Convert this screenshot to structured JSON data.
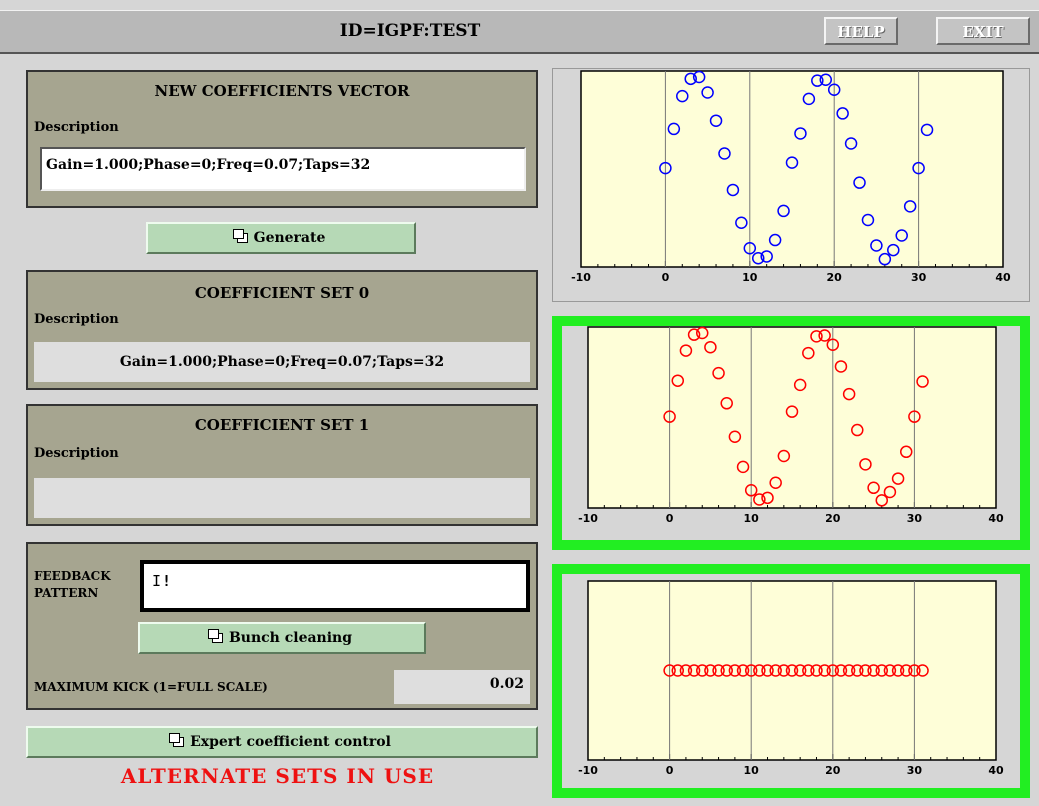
{
  "header": {
    "title": "ID=IGPF:TEST",
    "help_label": "HELP",
    "exit_label": "EXIT"
  },
  "new_coefficients": {
    "heading": "NEW COEFFICIENTS VECTOR",
    "description_label": "Description",
    "description_value": "Gain=1.000;Phase=0;Freq=0.07;Taps=32",
    "generate_label": "Generate"
  },
  "coefficient_set_0": {
    "heading": "COEFFICIENT SET 0",
    "description_label": "Description",
    "description_value": "Gain=1.000;Phase=0;Freq=0.07;Taps=32"
  },
  "coefficient_set_1": {
    "heading": "COEFFICIENT SET 1",
    "description_label": "Description",
    "description_value": ""
  },
  "feedback": {
    "label_line1": "FEEDBACK",
    "label_line2": "PATTERN",
    "pattern_value": "!",
    "bunch_cleaning_label": "Bunch cleaning",
    "max_kick_label": "MAXIMUM KICK (1=FULL SCALE)",
    "max_kick_value": "0.02"
  },
  "expert_control_label": "Expert coefficient control",
  "status_text": "ALTERNATE SETS IN USE",
  "colors": {
    "plot_bg": "#fefed8",
    "selected_frame": "#22ee22",
    "series_blue": "#0000ff",
    "series_red": "#ff0000",
    "alert": "#ee1111",
    "panel": "#a6a590",
    "button": "#b6d9b6"
  },
  "chart_data": [
    {
      "type": "scatter",
      "series": [
        {
          "color": "#0000ff",
          "x": [
            0,
            1,
            2,
            3,
            4,
            5,
            6,
            7,
            8,
            9,
            10,
            11,
            12,
            13,
            14,
            15,
            16,
            17,
            18,
            19,
            20,
            21,
            22,
            23,
            24,
            25,
            26,
            27,
            28,
            29,
            30,
            31
          ],
          "y": [
            0.0,
            0.43,
            0.79,
            0.98,
            1.0,
            0.83,
            0.52,
            0.16,
            -0.24,
            -0.6,
            -0.88,
            -0.99,
            -0.97,
            -0.79,
            -0.47,
            0.06,
            0.38,
            0.76,
            0.96,
            0.97,
            0.86,
            0.6,
            0.27,
            -0.16,
            -0.57,
            -0.85,
            -1.0,
            -0.9,
            -0.74,
            -0.42,
            0.0,
            0.42
          ]
        }
      ],
      "xticks": [
        -10,
        0,
        10,
        20,
        30,
        40
      ],
      "xlim": [
        -10,
        40
      ],
      "ylim": [
        -1.02,
        1.0
      ],
      "grid": "vertical"
    },
    {
      "type": "scatter",
      "series": [
        {
          "color": "#ff0000",
          "x": [
            0,
            1,
            2,
            3,
            4,
            5,
            6,
            7,
            8,
            9,
            10,
            11,
            12,
            13,
            14,
            15,
            16,
            17,
            18,
            19,
            20,
            21,
            22,
            23,
            24,
            25,
            26,
            27,
            28,
            29,
            30,
            31
          ],
          "y": [
            0.0,
            0.43,
            0.79,
            0.98,
            1.0,
            0.83,
            0.52,
            0.16,
            -0.24,
            -0.6,
            -0.88,
            -0.99,
            -0.97,
            -0.79,
            -0.47,
            0.06,
            0.38,
            0.76,
            0.96,
            0.97,
            0.86,
            0.6,
            0.27,
            -0.16,
            -0.57,
            -0.85,
            -1.0,
            -0.9,
            -0.74,
            -0.42,
            0.0,
            0.42
          ]
        }
      ],
      "xticks": [
        -10,
        0,
        10,
        20,
        30,
        40
      ],
      "xlim": [
        -10,
        40
      ],
      "ylim": [
        -1.02,
        1.0
      ],
      "grid": "vertical"
    },
    {
      "type": "scatter",
      "series": [
        {
          "color": "#ff0000",
          "x": [
            0,
            1,
            2,
            3,
            4,
            5,
            6,
            7,
            8,
            9,
            10,
            11,
            12,
            13,
            14,
            15,
            16,
            17,
            18,
            19,
            20,
            21,
            22,
            23,
            24,
            25,
            26,
            27,
            28,
            29,
            30,
            31
          ],
          "y": [
            0,
            0,
            0,
            0,
            0,
            0,
            0,
            0,
            0,
            0,
            0,
            0,
            0,
            0,
            0,
            0,
            0,
            0,
            0,
            0,
            0,
            0,
            0,
            0,
            0,
            0,
            0,
            0,
            0,
            0,
            0,
            0
          ]
        }
      ],
      "xticks": [
        -10,
        0,
        10,
        20,
        30,
        40
      ],
      "xlim": [
        -10,
        40
      ],
      "ylim": [
        -1,
        1
      ],
      "grid": "vertical"
    }
  ]
}
